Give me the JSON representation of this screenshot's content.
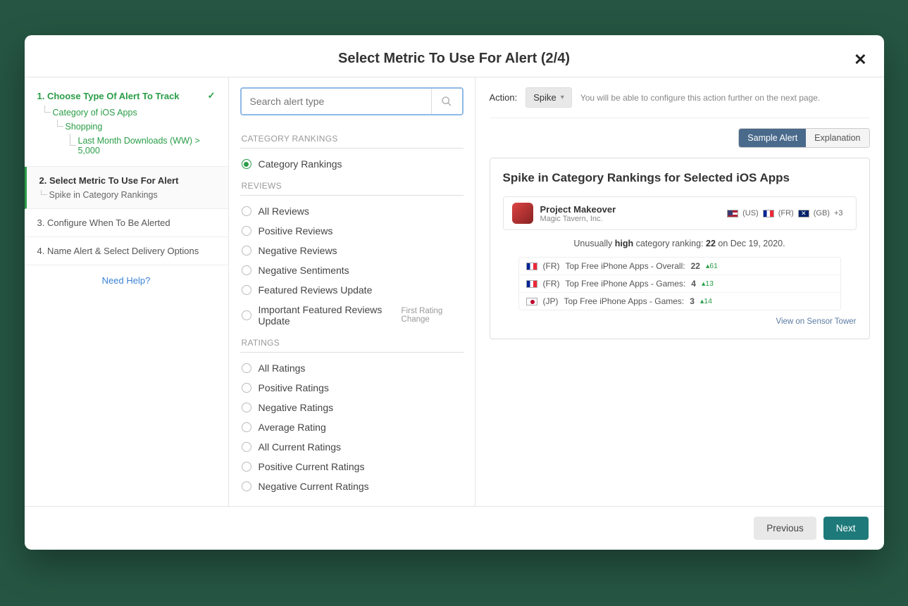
{
  "header": {
    "title": "Select Metric To Use For Alert (2/4)"
  },
  "sidebar": {
    "steps": [
      {
        "title": "1. Choose Type Of Alert To Track",
        "completed": true,
        "tree": [
          "Category of iOS Apps",
          "Shopping",
          "Last Month Downloads (WW) > 5,000"
        ]
      },
      {
        "title": "2. Select Metric To Use For Alert",
        "active": true,
        "subitem": "Spike in Category Rankings"
      },
      {
        "title": "3. Configure When To Be Alerted"
      },
      {
        "title": "4. Name Alert & Select Delivery Options"
      }
    ],
    "help": "Need Help?"
  },
  "search": {
    "placeholder": "Search alert type"
  },
  "groups": [
    {
      "title": "CATEGORY RANKINGS",
      "items": [
        {
          "label": "Category Rankings",
          "selected": true
        }
      ]
    },
    {
      "title": "REVIEWS",
      "items": [
        {
          "label": "All Reviews"
        },
        {
          "label": "Positive Reviews"
        },
        {
          "label": "Negative Reviews"
        },
        {
          "label": "Negative Sentiments"
        },
        {
          "label": "Featured Reviews Update"
        },
        {
          "label": "Important Featured Reviews Update",
          "sub": "First Rating Change"
        }
      ]
    },
    {
      "title": "RATINGS",
      "items": [
        {
          "label": "All Ratings"
        },
        {
          "label": "Positive Ratings"
        },
        {
          "label": "Negative Ratings"
        },
        {
          "label": "Average Rating"
        },
        {
          "label": "All Current Ratings"
        },
        {
          "label": "Positive Current Ratings"
        },
        {
          "label": "Negative Current Ratings"
        }
      ]
    }
  ],
  "action": {
    "label": "Action:",
    "value": "Spike",
    "hint": "You will be able to configure this action further on the next page."
  },
  "toggle": {
    "sample": "Sample Alert",
    "explanation": "Explanation"
  },
  "sample": {
    "title": "Spike in Category Rankings for Selected iOS Apps",
    "app": {
      "name": "Project Makeover",
      "publisher": "Magic Tavern, Inc."
    },
    "flags": [
      {
        "cls": "flag-us",
        "code": "(US)"
      },
      {
        "cls": "flag-fr",
        "code": "(FR)"
      },
      {
        "cls": "flag-gb",
        "code": "(GB)"
      }
    ],
    "extra": "+3",
    "unusual_pre": "Unusually ",
    "unusual_bold1": "high",
    "unusual_mid": " category ranking: ",
    "unusual_bold2": "22",
    "unusual_post": " on Dec 19, 2020.",
    "ranks": [
      {
        "flag": "flag-fr",
        "code": "(FR)",
        "text": "Top Free iPhone Apps - Overall:",
        "rank": "22",
        "delta": "▴61"
      },
      {
        "flag": "flag-fr",
        "code": "(FR)",
        "text": "Top Free iPhone Apps - Games:",
        "rank": "4",
        "delta": "▴13"
      },
      {
        "flag": "flag-jp",
        "code": "(JP)",
        "text": "Top Free iPhone Apps - Games:",
        "rank": "3",
        "delta": "▴14"
      }
    ],
    "view": "View on Sensor Tower"
  },
  "footer": {
    "prev": "Previous",
    "next": "Next"
  }
}
